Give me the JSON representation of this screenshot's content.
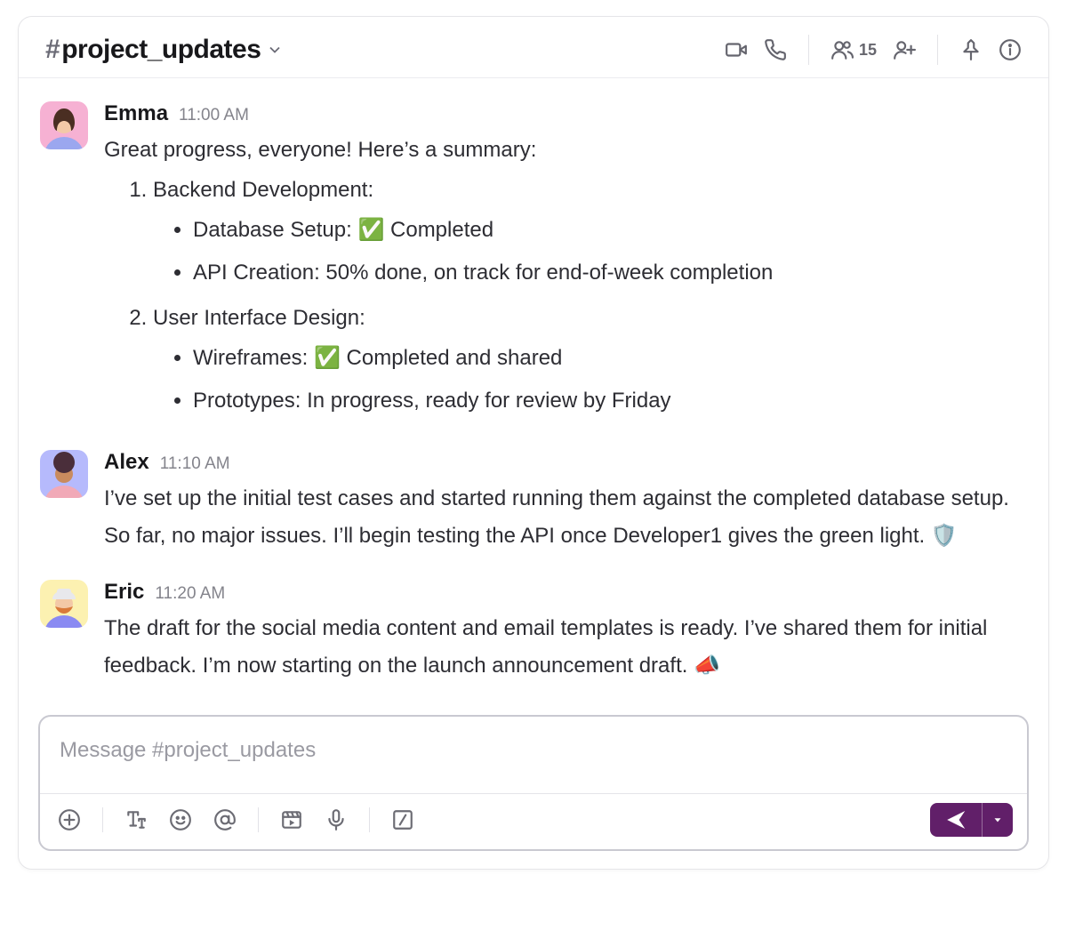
{
  "header": {
    "hash": "#",
    "channel_name": "project_updates",
    "member_count": "15"
  },
  "messages": [
    {
      "author": "Emma",
      "time": "11:00 AM",
      "avatar_bg": "#f6b1d3",
      "intro": "Great progress, everyone! Here’s a summary:",
      "summary": [
        {
          "heading": "Backend Development:",
          "items": [
            "Database Setup: ✅ Completed",
            "API Creation: 50% done, on track for end-of-week completion"
          ]
        },
        {
          "heading": "User Interface Design:",
          "items": [
            "Wireframes: ✅ Completed and shared",
            "Prototypes: In progress, ready for review by Friday"
          ]
        }
      ]
    },
    {
      "author": "Alex",
      "time": "11:10 AM",
      "avatar_bg": "#b6bafc",
      "text": "I’ve set up the initial test cases and started running them against the completed database setup. So far, no major issues. I’ll begin testing the API once Developer1 gives the green light. 🛡️"
    },
    {
      "author": "Eric",
      "time": "11:20 AM",
      "avatar_bg": "#fcf1b1",
      "text": "The draft for the social media content and email templates is ready. I’ve shared them for initial feedback. I’m now starting on the launch announcement draft. 📣"
    }
  ],
  "composer": {
    "placeholder": "Message #project_updates"
  }
}
